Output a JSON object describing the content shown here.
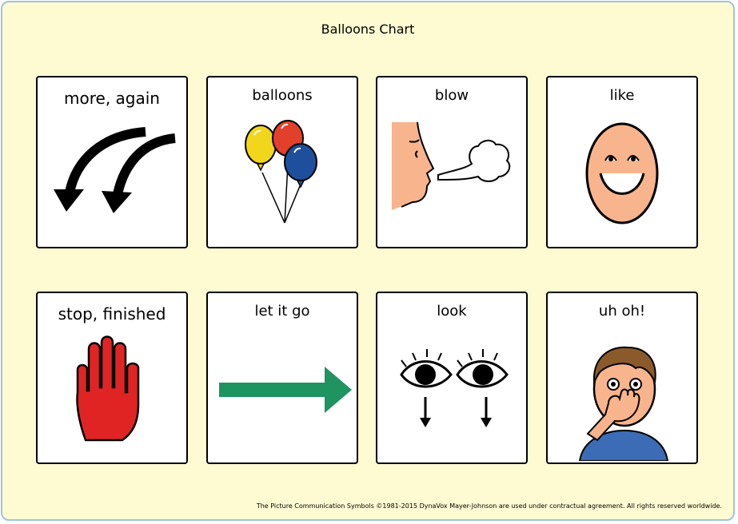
{
  "chart": {
    "title": "Balloons Chart",
    "footer": "The Picture Communication Symbols ©1981-2015 DynaVox Mayer-Johnson are used under contractual agreement.  All rights reserved worldwide."
  },
  "cards": [
    {
      "label": "more, again",
      "icon": "curved-arrows-icon"
    },
    {
      "label": "balloons",
      "icon": "balloons-icon"
    },
    {
      "label": "blow",
      "icon": "blowing-face-icon"
    },
    {
      "label": "like",
      "icon": "smiling-face-icon"
    },
    {
      "label": "stop, finished",
      "icon": "stop-hand-icon"
    },
    {
      "label": "let it go",
      "icon": "right-arrow-icon"
    },
    {
      "label": "look",
      "icon": "eyes-looking-down-icon"
    },
    {
      "label": "uh oh!",
      "icon": "surprised-boy-icon"
    }
  ],
  "colors": {
    "background": "#fefbd2",
    "border": "#9ec4dd",
    "balloon_yellow": "#f2d61c",
    "balloon_red": "#e2402a",
    "balloon_blue": "#1d4f9c",
    "stop_hand_red": "#e02424",
    "arrow_green": "#1f9360",
    "skin": "#f8b48c"
  }
}
